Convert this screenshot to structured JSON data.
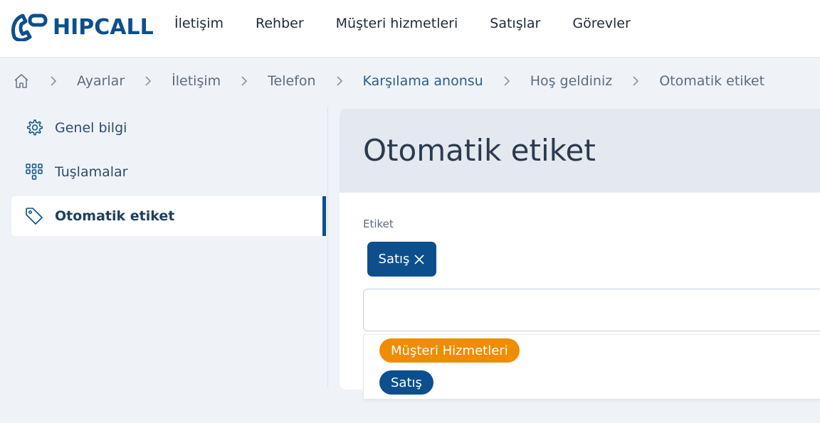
{
  "app": {
    "logo_text": "HIPCALL"
  },
  "nav": {
    "items": [
      "İletişim",
      "Rehber",
      "Müşteri hizmetleri",
      "Satışlar",
      "Görevler"
    ]
  },
  "breadcrumb": {
    "items": [
      "Ayarlar",
      "İletişim",
      "Telefon",
      "Karşılama anonsu",
      "Hoş geldiniz",
      "Otomatik etiket"
    ]
  },
  "sidebar": {
    "items": [
      {
        "label": "Genel bilgi",
        "icon": "gear-icon"
      },
      {
        "label": "Tuşlamalar",
        "icon": "keypad-icon"
      },
      {
        "label": "Otomatik etiket",
        "icon": "tag-icon",
        "active": true
      }
    ]
  },
  "panel": {
    "title": "Otomatik etiket",
    "field_label": "Etiket",
    "selected_tag": "Satış",
    "input_value": ""
  },
  "dropdown": {
    "options": [
      {
        "label": "Müşteri Hizmetleri",
        "color": "#f08c00"
      },
      {
        "label": "Satış",
        "color": "#0d4f8c"
      }
    ]
  },
  "colors": {
    "brand": "#0d4f8c",
    "orange": "#f08c00"
  }
}
